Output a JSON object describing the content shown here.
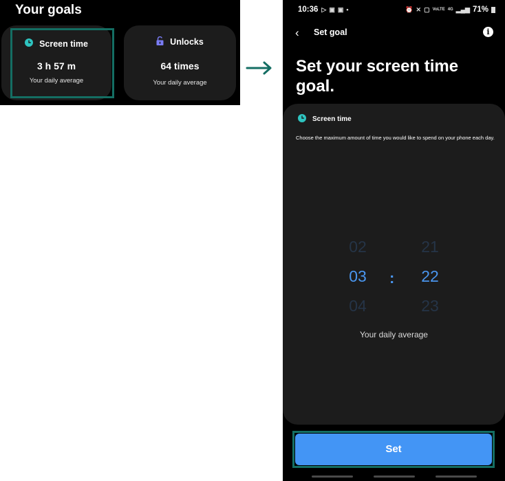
{
  "left": {
    "title": "Your goals",
    "cards": [
      {
        "icon": "clock-icon",
        "label": "Screen time",
        "value": "3 h 57 m",
        "sub": "Your daily average",
        "highlighted": true
      },
      {
        "icon": "unlock-icon",
        "label": "Unlocks",
        "value": "64 times",
        "sub": "Your daily average",
        "highlighted": false
      }
    ]
  },
  "arrow_icon": "arrow-right-icon",
  "phone": {
    "status_bar": {
      "time": "10:36",
      "left_icons": [
        "play-store-icon",
        "notification-icon",
        "notification-icon",
        "dot-icon"
      ],
      "right_icons": [
        "alarm-icon",
        "mute-icon",
        "sim-icon",
        "volte-icon",
        "4g-icon",
        "signal-icon"
      ],
      "battery": "71%"
    },
    "app_bar": {
      "back_icon": "back-chevron-icon",
      "title": "Set goal",
      "info_icon": "info-icon"
    },
    "page_title": "Set your screen time goal.",
    "panel": {
      "label": "Screen time",
      "description": "Choose the maximum amount of time you would like to spend on your phone each day.",
      "picker": {
        "hours": {
          "prev": "02",
          "selected": "03",
          "next": "04"
        },
        "separator": ":",
        "minutes": {
          "prev": "21",
          "selected": "22",
          "next": "23"
        }
      },
      "caption": "Your daily average"
    },
    "set_button": "Set"
  },
  "colors": {
    "accent": "#4395f5",
    "highlight": "#146e63",
    "clock": "#2ec4c0",
    "unlock": "#7a7cf5"
  }
}
